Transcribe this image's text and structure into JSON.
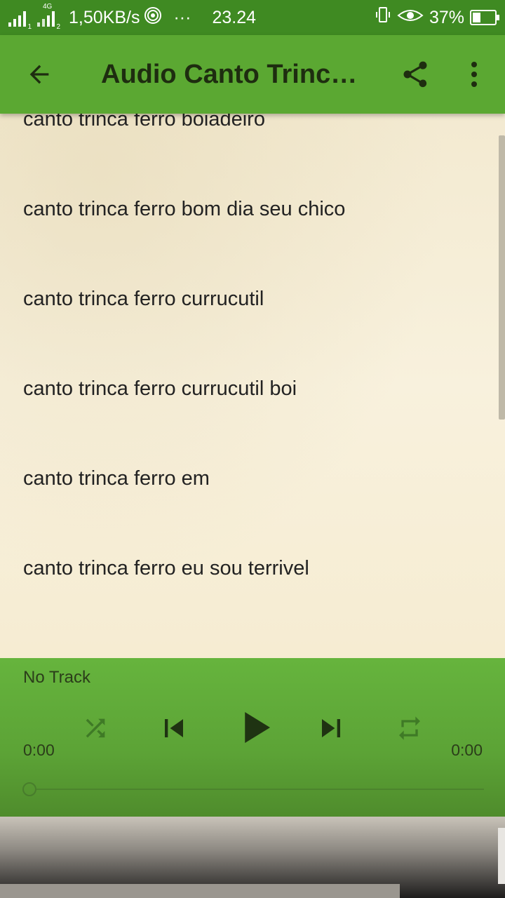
{
  "status_bar": {
    "sim1": "1",
    "sim2": "2",
    "network": "4G",
    "speed": "1,50KB/s",
    "more": "···",
    "time": "23.24",
    "battery": "37%",
    "battery_level": 0.37
  },
  "app_bar": {
    "title": "Audio Canto Trinca Ferro"
  },
  "list": {
    "items": [
      "canto trinca ferro boiadeiro",
      "canto trinca ferro bom dia seu chico",
      "canto trinca ferro currucutil",
      "canto trinca ferro currucutil boi",
      "canto trinca ferro em",
      "canto trinca ferro eu sou terrivel"
    ]
  },
  "player": {
    "track": "No Track",
    "elapsed": "0:00",
    "duration": "0:00",
    "progress": 0
  },
  "icons": {
    "back": "arrow-left-icon",
    "share": "share-icon",
    "menu": "more-vert-icon",
    "shuffle": "shuffle-icon",
    "previous": "skip-previous-icon",
    "play": "play-icon",
    "next": "skip-next-icon",
    "repeat": "repeat-icon"
  },
  "colors": {
    "app_bar": "#5ba832",
    "status_bar": "#3f8a22",
    "player": "#5ca336"
  }
}
